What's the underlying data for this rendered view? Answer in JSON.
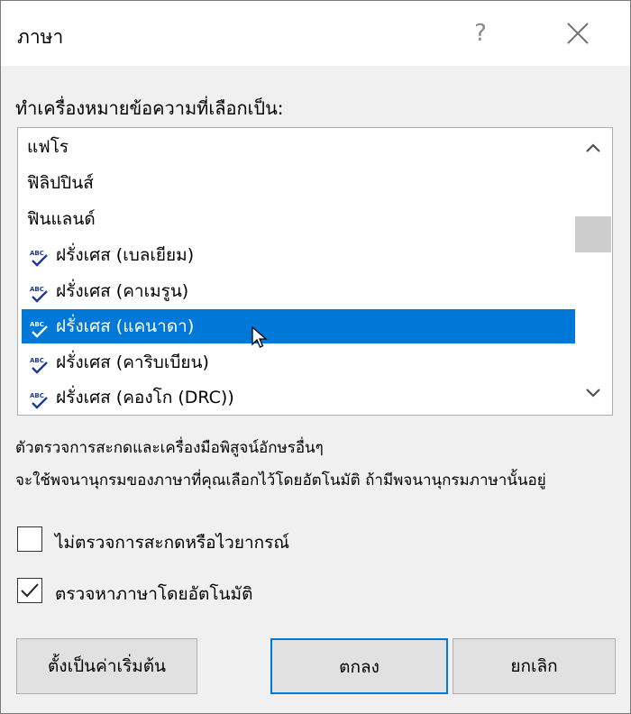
{
  "dialog": {
    "title": "ภาษา",
    "help_label": "?",
    "prompt": "ทำเครื่องหมายข้อความที่เลือกเป็น:",
    "languages": [
      {
        "label": "แฟโร",
        "spellcheck": false,
        "selected": false
      },
      {
        "label": "ฟิลิปปินส์",
        "spellcheck": false,
        "selected": false
      },
      {
        "label": "ฟินแลนด์",
        "spellcheck": false,
        "selected": false
      },
      {
        "label": "ฝรั่งเศส (เบลเยียม)",
        "spellcheck": true,
        "selected": false
      },
      {
        "label": "ฝรั่งเศส (คาเมรูน)",
        "spellcheck": true,
        "selected": false
      },
      {
        "label": "ฝรั่งเศส (แคนาดา)",
        "spellcheck": true,
        "selected": true
      },
      {
        "label": "ฝรั่งเศส (คาริบเบียน)",
        "spellcheck": true,
        "selected": false
      },
      {
        "label": "ฝรั่งเศส (คองโก (DRC))",
        "spellcheck": true,
        "selected": false
      }
    ],
    "info_line1": "ตัวตรวจการสะกดและเครื่องมือพิสูจน์อักษรอื่นๆ",
    "info_line2": "จะใช้พจนานุกรมของภาษาที่คุณเลือกไว้โดยอัตโนมัติ ถ้ามีพจนานุกรมภาษานั้นอยู่",
    "checkbox_no_proof": {
      "label": "ไม่ตรวจการสะกดหรือไวยากรณ์",
      "checked": false
    },
    "checkbox_detect": {
      "label": "ตรวจหาภาษาโดยอัตโนมัติ",
      "checked": true
    },
    "buttons": {
      "set_default": "ตั้งเป็นค่าเริ่มต้น",
      "ok": "ตกลง",
      "cancel": "ยกเลิก"
    },
    "colors": {
      "selection": "#0078d7",
      "default_button_border": "#0078d7"
    }
  }
}
